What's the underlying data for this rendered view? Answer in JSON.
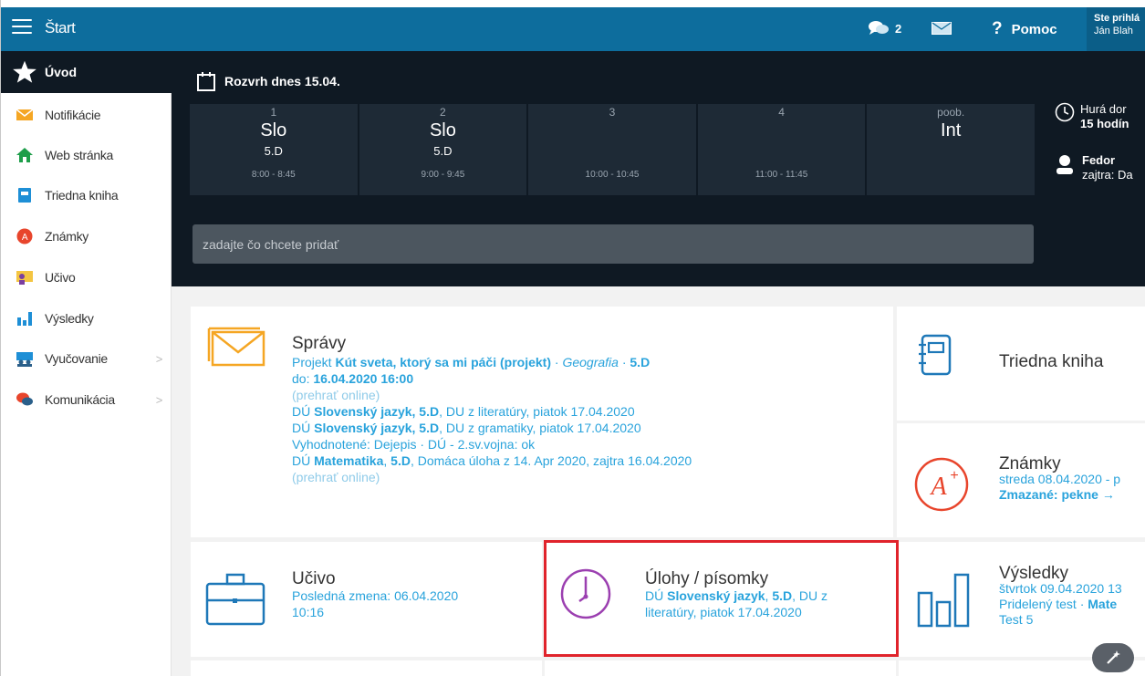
{
  "topbar": {
    "start_label": "Štart",
    "chat_count": "2",
    "help_label": "Pomoc",
    "user_line1": "Ste prihlá",
    "user_line2": "Ján Blah"
  },
  "sidebar": {
    "items": [
      {
        "label": "Úvod",
        "icon": "star-icon"
      },
      {
        "label": "Notifikácie",
        "icon": "envelope-icon"
      },
      {
        "label": "Web stránka",
        "icon": "home-icon"
      },
      {
        "label": "Triedna kniha",
        "icon": "book-icon"
      },
      {
        "label": "Známky",
        "icon": "grade-icon"
      },
      {
        "label": "Učivo",
        "icon": "teacher-icon"
      },
      {
        "label": "Výsledky",
        "icon": "bar-chart-icon"
      },
      {
        "label": "Vyučovanie",
        "icon": "class-icon"
      },
      {
        "label": "Komunikácia",
        "icon": "chat-icon"
      }
    ]
  },
  "schedule": {
    "title": "Rozvrh dnes 15.04.",
    "slots": [
      {
        "num": "1",
        "subject": "Slo",
        "class": "5.D",
        "time": "8:00 - 8:45"
      },
      {
        "num": "2",
        "subject": "Slo",
        "class": "5.D",
        "time": "9:00 - 9:45"
      },
      {
        "num": "3",
        "subject": "",
        "class": "",
        "time": "10:00 - 10:45"
      },
      {
        "num": "4",
        "subject": "",
        "class": "",
        "time": "11:00 - 11:45"
      },
      {
        "num": "poob.",
        "subject": "Int",
        "class": "",
        "time": ""
      }
    ],
    "add_placeholder": "zadajte čo chcete pridať"
  },
  "right_info": {
    "line1a": "Hurá dor",
    "line1b": "15 hodín",
    "name": "Fedor",
    "name_sub": "zajtra: Da"
  },
  "spravy": {
    "title": "Správy",
    "l1_pre": "Projekt ",
    "l1_bold": "Kút sveta, ktorý sa mi páči (projekt)",
    "l1_sep": " · ",
    "l1_italic": "Geografia",
    "l1_sep2": " · ",
    "l1_class": "5.D",
    "l2_pre": "do: ",
    "l2_bold": "16.04.2020 16:00",
    "l3": "(prehrať online)",
    "l4_pre": "DÚ ",
    "l4_bold": "Slovenský jazyk, 5.D",
    "l4_post": ", DU z literatúry, piatok 17.04.2020",
    "l5_pre": "DÚ ",
    "l5_bold": "Slovenský jazyk, 5.D",
    "l5_post": ", DU z gramatiky, piatok 17.04.2020",
    "l6": "Vyhodnotené: Dejepis · DÚ - 2.sv.vojna: ok",
    "l7_pre": "DÚ ",
    "l7_bold": "Matematika",
    "l7_mid": ", ",
    "l7_bold2": "5.D",
    "l7_post": ", Domáca úloha z 14. Apr 2020, zajtra 16.04.2020",
    "l8": "(prehrať online)"
  },
  "triedna": {
    "title": "Triedna kniha"
  },
  "znamky": {
    "title": "Známky",
    "l1": "streda 08.04.2020 - p",
    "l2": "Zmazané: pekne →"
  },
  "ucivo": {
    "title": "Učivo",
    "l1": "Posledná zmena: 06.04.2020",
    "l2": "10:16"
  },
  "ulohy": {
    "title": "Úlohy / písomky",
    "l1_pre": "DÚ ",
    "l1_bold": "Slovenský jazyk",
    "l1_mid": ", ",
    "l1_bold2": "5.D",
    "l1_post": ", DU z",
    "l2": "literatúry, piatok 17.04.2020"
  },
  "vysledky": {
    "title": "Výsledky",
    "l1": "štvrtok 09.04.2020 13",
    "l2_pre": "Pridelený test · ",
    "l2_bold": "Mate",
    "l3": "Test 5"
  },
  "colors": {
    "topbar": "#0d6d9d",
    "dark": "#0f1923",
    "accent_blue": "#29a3dc",
    "orange": "#f5a623",
    "purple": "#9b3fb0",
    "red": "#e0232b"
  }
}
